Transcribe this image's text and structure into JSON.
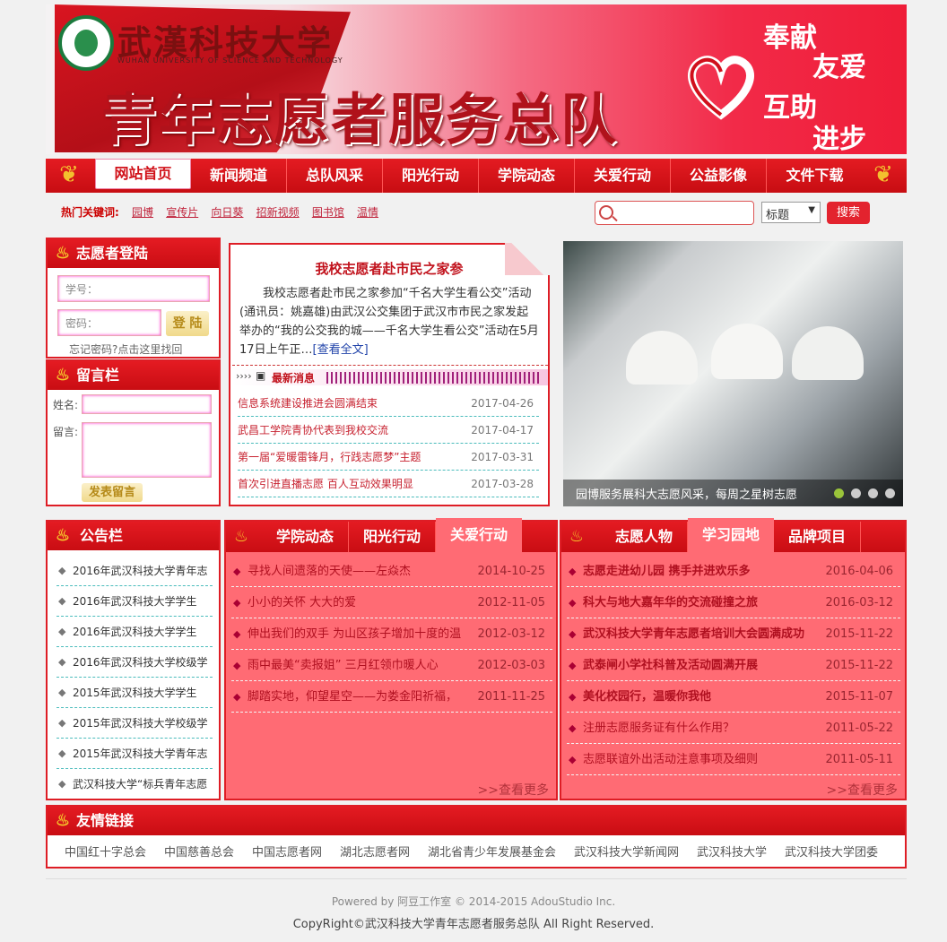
{
  "banner": {
    "univ_name": "武漢科技大学",
    "univ_en": "WUHAN UNIVERSITY OF SCIENCE AND TECHNOLOGY",
    "title": "青年志愿者服务总队",
    "slogans": [
      "奉献",
      "友爱",
      "互助",
      "进步"
    ]
  },
  "nav": {
    "items": [
      "网站首页",
      "新闻频道",
      "总队风采",
      "阳光行动",
      "学院动态",
      "关爱行动",
      "公益影像",
      "文件下载"
    ]
  },
  "hot": {
    "label": "热门关键词:",
    "keywords": [
      "园博",
      "宣传片",
      "向日葵",
      "招新视频",
      "图书馆",
      "温情"
    ]
  },
  "search": {
    "select": "标题",
    "button": "搜索"
  },
  "login": {
    "title": "志愿者登陆",
    "user_placeholder": "学号：",
    "pwd_placeholder": "密码：",
    "button": "登 陆",
    "forgot": "忘记密码?点击这里找回"
  },
  "message": {
    "title": "留言栏",
    "name_label": "姓名:",
    "msg_label": "留言:",
    "button": "发表留言"
  },
  "feature": {
    "title": "我校志愿者赴市民之家参",
    "body": "我校志愿者赴市民之家参加“千名大学生看公交”活动(通讯员：姚嘉雄)由武汉公交集团于武汉市市民之家发起举办的“我的公交我的城——千名大学生看公交”活动在5月17日上午正…",
    "more": "[查看全文]",
    "latest_label": "最新消息",
    "news": [
      {
        "t": "信息系统建设推进会圆满结束",
        "d": "2017-04-26"
      },
      {
        "t": "武昌工学院青协代表到我校交流",
        "d": "2017-04-17"
      },
      {
        "t": "第一届“爱暖雷锋月，行践志愿梦”主题",
        "d": "2017-03-31"
      },
      {
        "t": "首次引进直播志愿 百人互动效果明显",
        "d": "2017-03-28"
      }
    ]
  },
  "slide": {
    "caption": "园博服务展科大志愿风采，每周之星树志愿"
  },
  "notice": {
    "title": "公告栏",
    "items": [
      "2016年武汉科技大学青年志",
      "2016年武汉科技大学学生",
      "2016年武汉科技大学学生",
      "2016年武汉科技大学校级学",
      "2015年武汉科技大学学生",
      "2015年武汉科技大学校级学",
      "2015年武汉科技大学青年志",
      "武汉科技大学“标兵青年志愿"
    ]
  },
  "mid": {
    "tabs": [
      "学院动态",
      "阳光行动",
      "关爱行动"
    ],
    "rows": [
      {
        "t": "寻找人间遗落的天使——左焱杰",
        "d": "2014-10-25"
      },
      {
        "t": "小小的关怀 大大的爱",
        "d": "2012-11-05"
      },
      {
        "t": "伸出我们的双手 为山区孩子增加十度的温",
        "d": "2012-03-12"
      },
      {
        "t": "雨中最美“卖报姐” 三月红领巾暖人心",
        "d": "2012-03-03"
      },
      {
        "t": "脚踏实地，仰望星空——为娄金阳祈福，",
        "d": "2011-11-25"
      }
    ],
    "more": ">>查看更多"
  },
  "right": {
    "tabs": [
      "志愿人物",
      "学习园地",
      "品牌项目"
    ],
    "rows": [
      {
        "t": "志愿走进幼儿园 携手并进欢乐多",
        "d": "2016-04-06"
      },
      {
        "t": "科大与地大嘉年华的交流碰撞之旅",
        "d": "2016-03-12"
      },
      {
        "t": "武汉科技大学青年志愿者培训大会圆满成功",
        "d": "2015-11-22"
      },
      {
        "t": "武泰闸小学社科普及活动圆满开展",
        "d": "2015-11-22"
      },
      {
        "t": "美化校园行，温暖你我他",
        "d": "2015-11-07"
      },
      {
        "t": "注册志愿服务证有什么作用？",
        "d": "2011-05-22"
      },
      {
        "t": "志愿联谊外出活动注意事项及细则",
        "d": "2011-05-11"
      }
    ],
    "more": ">>查看更多"
  },
  "links": {
    "title": "友情链接",
    "items": [
      "中国红十字总会",
      "中国慈善总会",
      "中国志愿者网",
      "湖北志愿者网",
      "湖北省青少年发展基金会",
      "武汉科技大学新闻网",
      "武汉科技大学",
      "武汉科技大学团委"
    ]
  },
  "footer": {
    "powered": "Powered by 阿豆工作室 © 2014-2015 AdouStudio Inc.",
    "copyright": "CopyRight©武汉科技大学青年志愿者服务总队 All Right Reserved."
  }
}
